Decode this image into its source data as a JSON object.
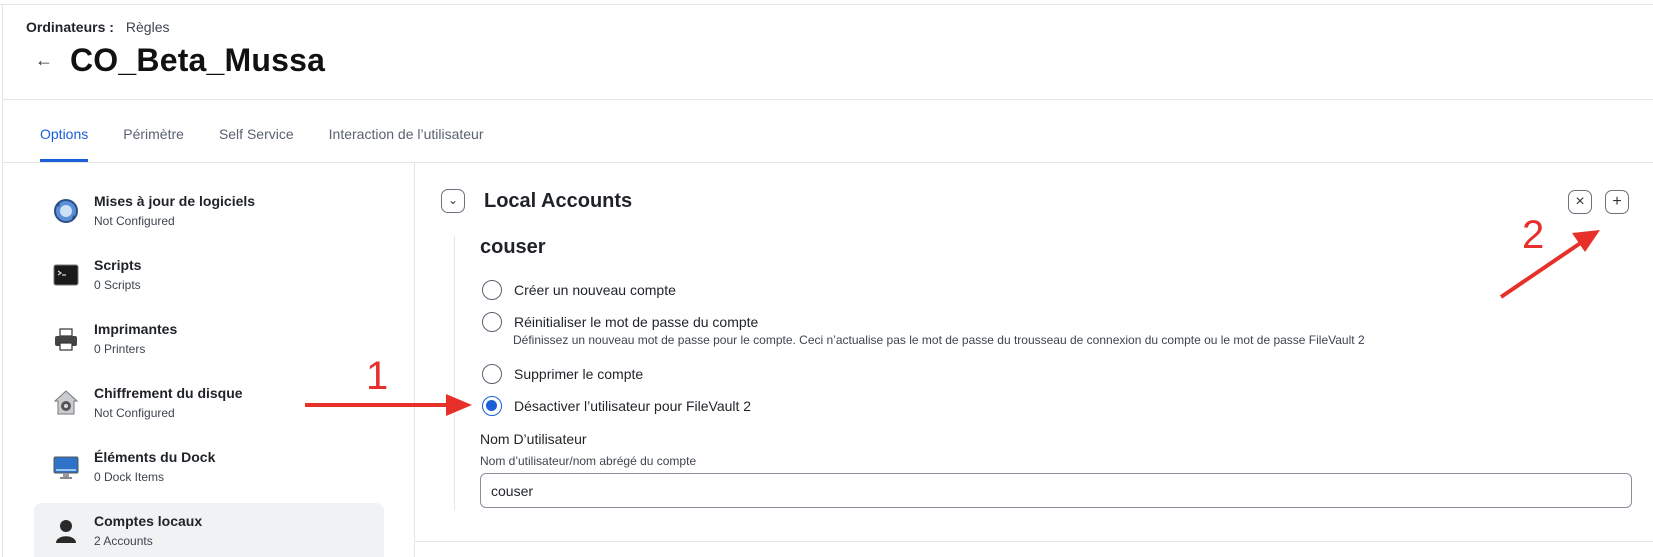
{
  "breadcrumb": {
    "parent": "Ordinateurs :",
    "current": "Règles"
  },
  "page_title": "CO_Beta_Mussa",
  "tabs": [
    {
      "label": "Options",
      "active": true
    },
    {
      "label": "Périmètre",
      "active": false
    },
    {
      "label": "Self Service",
      "active": false
    },
    {
      "label": "Interaction de l’utilisateur",
      "active": false
    }
  ],
  "sidebar": {
    "items": [
      {
        "label": "Mises à jour de logiciels",
        "sub": "Not Configured",
        "icon": "software-update-icon"
      },
      {
        "label": "Scripts",
        "sub": "0 Scripts",
        "icon": "terminal-icon"
      },
      {
        "label": "Imprimantes",
        "sub": "0 Printers",
        "icon": "printer-icon"
      },
      {
        "label": "Chiffrement du disque",
        "sub": "Not Configured",
        "icon": "disk-encryption-icon"
      },
      {
        "label": "Éléments du Dock",
        "sub": "0 Dock Items",
        "icon": "dock-icon"
      },
      {
        "label": "Comptes locaux",
        "sub": "2 Accounts",
        "icon": "user-icon",
        "selected": true
      }
    ]
  },
  "main": {
    "section_title": "Local Accounts",
    "account_name": "couser",
    "options": [
      {
        "label": "Créer un nouveau compte",
        "checked": false
      },
      {
        "label": "Réinitialiser le mot de passe du compte",
        "checked": false,
        "description": "Définissez un nouveau mot de passe pour le compte. Ceci n’actualise pas le mot de passe du trousseau de connexion du compte ou le mot de passe FileVault 2"
      },
      {
        "label": "Supprimer le compte",
        "checked": false
      },
      {
        "label": "Désactiver l’utilisateur pour FileVault 2",
        "checked": true
      }
    ],
    "username_field": {
      "label": "Nom D’utilisateur",
      "help": "Nom d’utilisateur/nom abrégé du compte",
      "value": "couser"
    },
    "remove_glyph": "×",
    "add_glyph": "+",
    "collapse_glyph": "⌄"
  },
  "annotations": {
    "one": "1",
    "two": "2",
    "color": "#e8302a"
  },
  "colors": {
    "accent": "#1a5fd8",
    "border": "#e3e5e8",
    "selected_bg": "#f0f2f4"
  }
}
